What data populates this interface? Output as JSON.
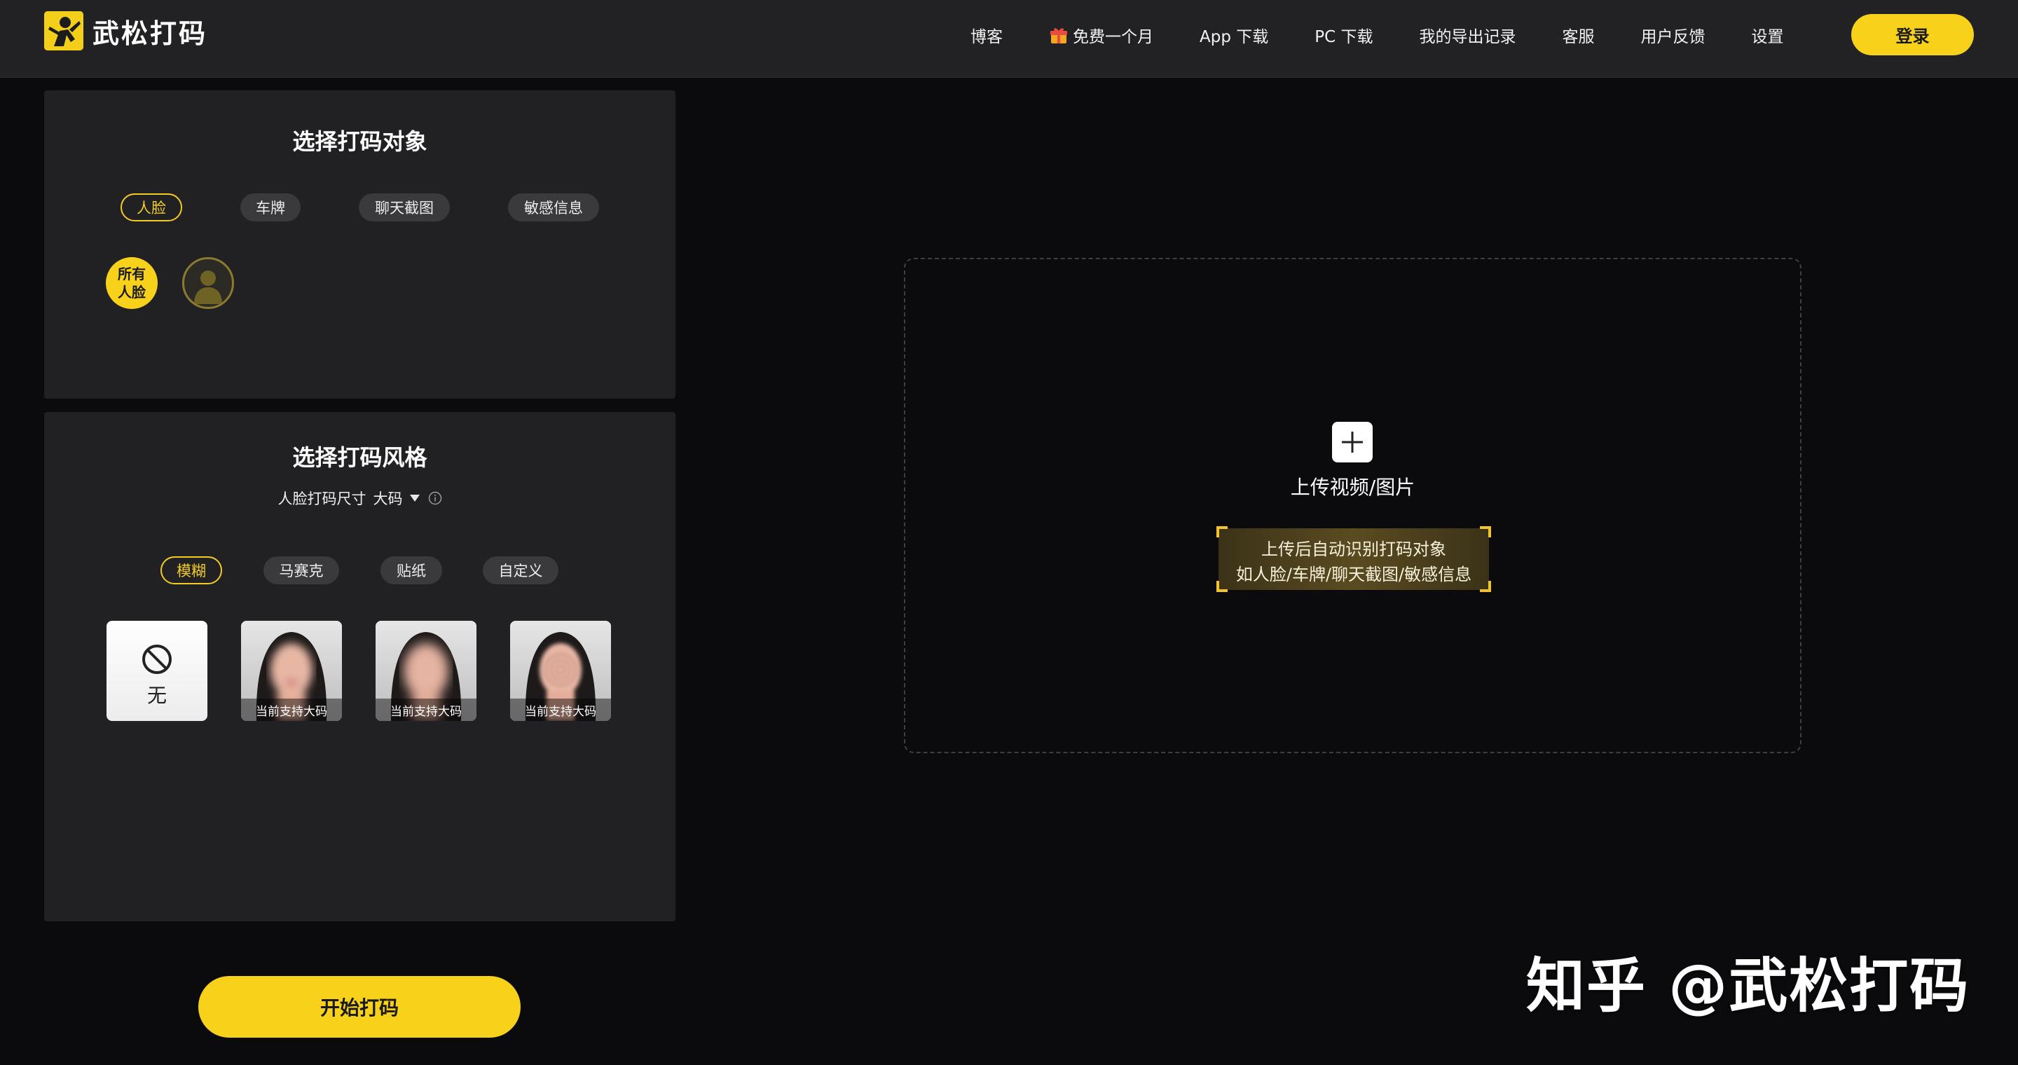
{
  "app": {
    "brand": "武松打码"
  },
  "nav": {
    "items": [
      "博客",
      "免费一个月",
      "App 下载",
      "PC 下载",
      "我的导出记录",
      "客服",
      "用户反馈",
      "设置"
    ],
    "login": "登录"
  },
  "target_panel": {
    "title": "选择打码对象",
    "tabs": [
      "人脸",
      "车牌",
      "聊天截图",
      "敏感信息"
    ],
    "active_tab": "人脸",
    "all_faces_line1": "所有",
    "all_faces_line2": "人脸"
  },
  "style_panel": {
    "title": "选择打码风格",
    "size_label": "人脸打码尺寸",
    "size_value": "大码",
    "tabs": [
      "模糊",
      "马赛克",
      "贴纸",
      "自定义"
    ],
    "active_tab": "模糊",
    "none_label": "无",
    "card_caption": "当前支持大码"
  },
  "start_button": "开始打码",
  "upload": {
    "label": "上传视频/图片",
    "hint_line1": "上传后自动识别打码对象",
    "hint_line2": "如人脸/车牌/聊天截图/敏感信息"
  },
  "watermark": "知乎 @武松打码",
  "colors": {
    "accent": "#f8d21a",
    "background": "#0b0b0e",
    "panel": "#212123",
    "header": "#222224"
  }
}
